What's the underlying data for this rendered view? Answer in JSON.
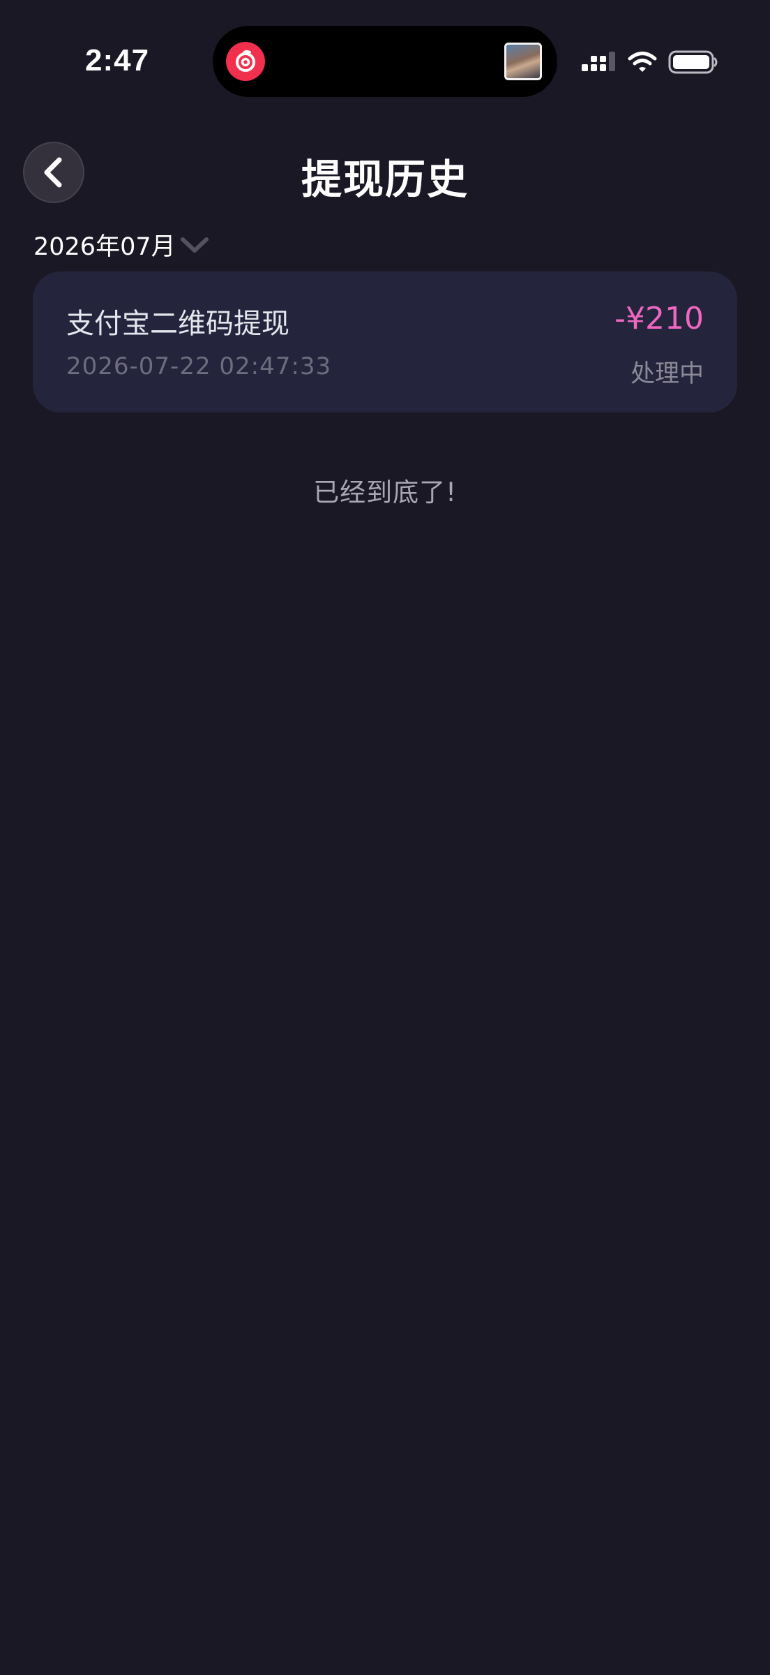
{
  "status_bar": {
    "time": "2:47"
  },
  "header": {
    "title": "提现历史"
  },
  "filter": {
    "month": "2026年07月"
  },
  "records": [
    {
      "title": "支付宝二维码提现",
      "time": "2026-07-22 02:47:33",
      "amount": "-¥210",
      "status": "处理中"
    }
  ],
  "list_end_text": "已经到底了!",
  "colors": {
    "background": "#1b1825",
    "card": "#24243c",
    "amount": "#ee68c1"
  }
}
